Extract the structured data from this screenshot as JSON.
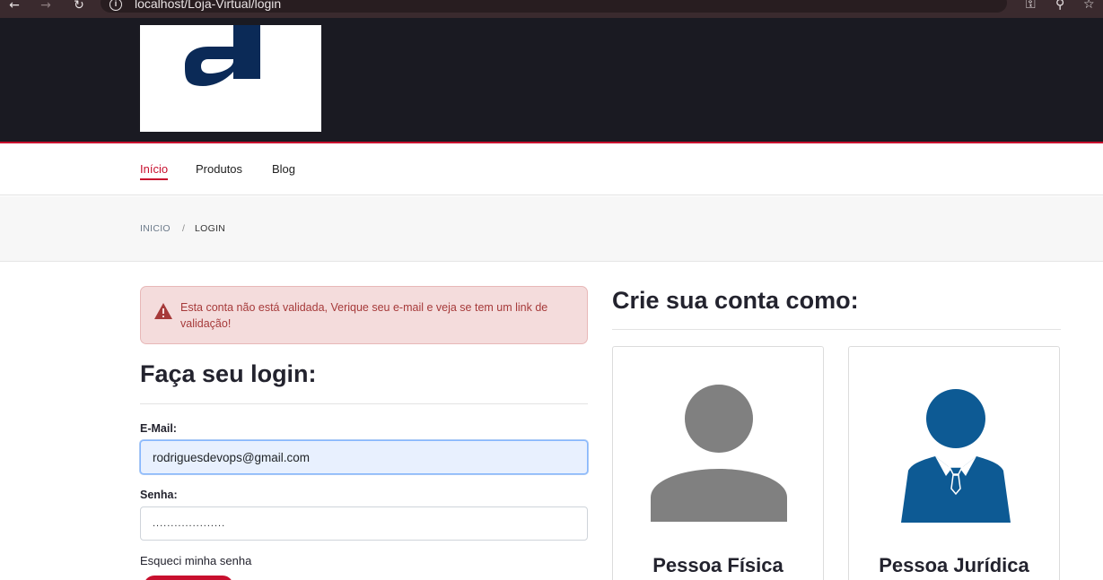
{
  "browser": {
    "back_icon": "arrow-left-icon",
    "forward_icon": "arrow-right-icon",
    "reload_icon": "reload-icon",
    "url": "localhost/Loja-Virtual/login",
    "key_icon": "key-icon",
    "zoom_icon": "zoom-icon",
    "star_icon": "star-icon"
  },
  "nav": {
    "items": [
      {
        "label": "Início"
      },
      {
        "label": "Produtos"
      },
      {
        "label": "Blog"
      }
    ]
  },
  "breadcrumb": {
    "home": "INICIO",
    "separator": "/",
    "current": "LOGIN"
  },
  "alert": {
    "icon": "warning-icon",
    "message": "Esta conta não está validada, Verique seu e-mail e veja se tem um link de validação!"
  },
  "login": {
    "title": "Faça seu login:",
    "email_label": "E-Mail:",
    "email_value": "rodriguesdevops@gmail.com",
    "password_label": "Senha:",
    "password_value": "....................",
    "forgot_label": "Esqueci minha senha"
  },
  "register": {
    "title": "Crie sua conta como:",
    "cards": [
      {
        "label": "Pessoa Física",
        "icon": "person-icon"
      },
      {
        "label": "Pessoa Jurídica",
        "icon": "business-person-icon"
      }
    ]
  },
  "colors": {
    "accent": "#c8102e",
    "header_bg": "#1a1a22",
    "person_gray": "#808080",
    "business_blue": "#0d5a94"
  }
}
